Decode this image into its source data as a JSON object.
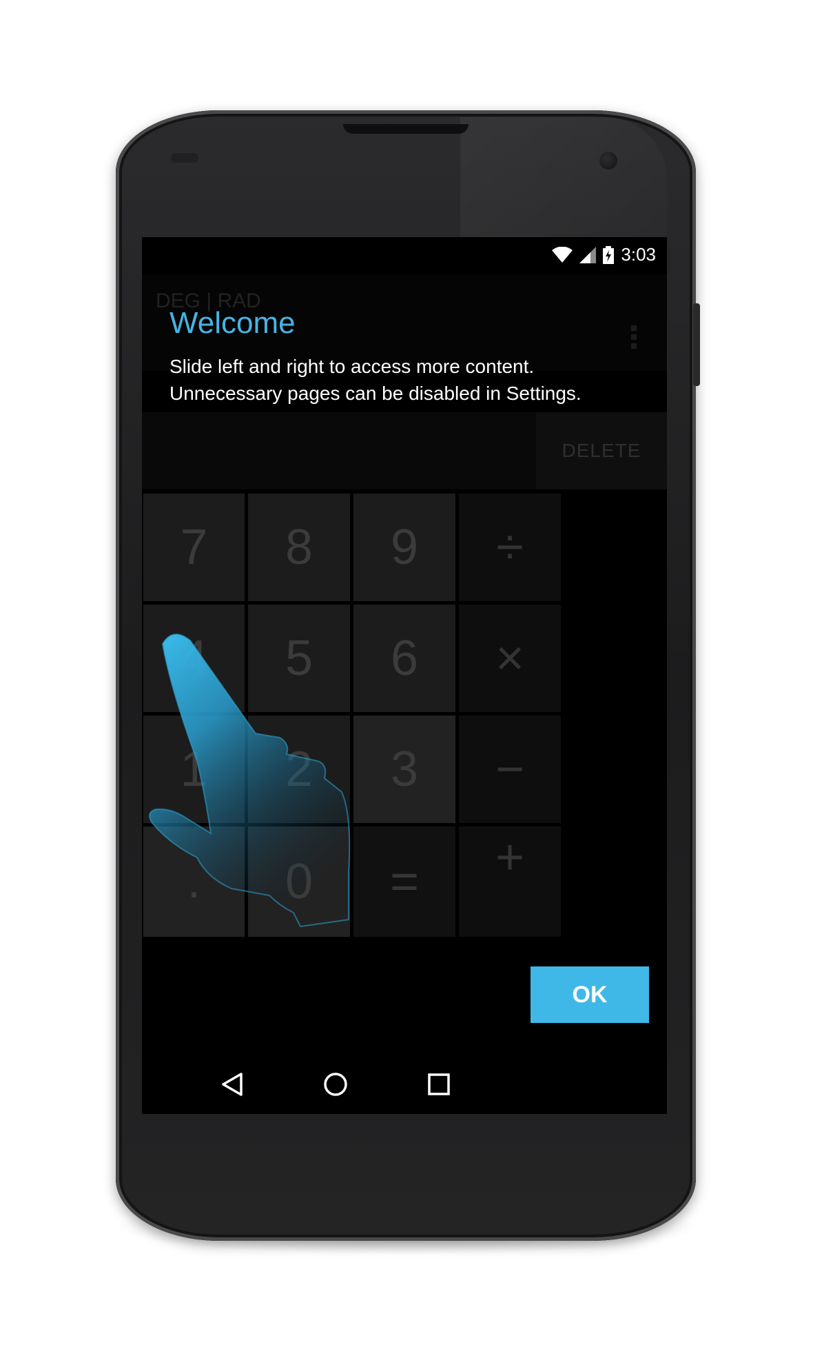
{
  "status_bar": {
    "time": "3:03",
    "icons": [
      "wifi-icon",
      "signal-icon",
      "battery-charging-icon"
    ]
  },
  "app": {
    "mode_label": "DEG | RAD",
    "menu_icon": "overflow-menu-icon",
    "delete_label": "DELETE"
  },
  "keypad": {
    "rows": [
      [
        "7",
        "8",
        "9",
        "÷"
      ],
      [
        "4",
        "5",
        "6",
        "×"
      ],
      [
        "1",
        "2",
        "3",
        "−"
      ],
      [
        ".",
        "0",
        "=",
        "+"
      ]
    ]
  },
  "welcome": {
    "title": "Welcome",
    "body": "Slide left and right to access more content. Unnecessary pages can be disabled in Settings.",
    "ok_label": "OK",
    "hint_icon": "swipe-hand-icon"
  },
  "nav_bar": {
    "back_icon": "back-icon",
    "home_icon": "home-icon",
    "recents_icon": "recents-icon"
  },
  "colors": {
    "accent": "#3fb8e8",
    "title": "#45b4e4",
    "background": "#000000"
  }
}
